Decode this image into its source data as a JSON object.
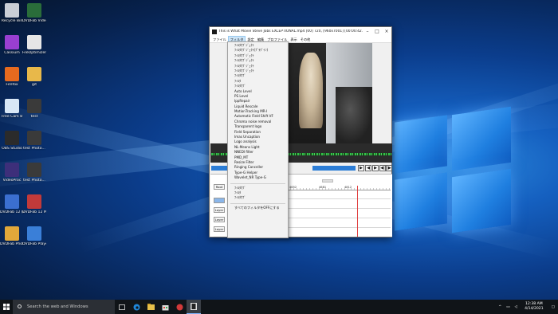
{
  "desktop": {
    "icons": [
      {
        "label": "Recycle Bin",
        "color": "#c9ced6"
      },
      {
        "label": "DVDFab Video Enh...",
        "color": "#2a6d3a"
      },
      {
        "label": "Cassium",
        "color": "#9a3fd0"
      },
      {
        "label": "FileOptimizer",
        "color": "#e6e6e6"
      },
      {
        "label": "Firefox",
        "color": "#e66a1f"
      },
      {
        "label": "git",
        "color": "#e8b84a"
      },
      {
        "label": "Free Cam 8",
        "color": "#d9e7f5"
      },
      {
        "label": "test",
        "color": "#3a3a3a"
      },
      {
        "label": "OBS Studio",
        "color": "#2b2b2b"
      },
      {
        "label": "test Photo...",
        "color": "#3a3a3a"
      },
      {
        "label": "VideoProc",
        "color": "#3d2f7a"
      },
      {
        "label": "test Photo...",
        "color": "#3a3a3a"
      },
      {
        "label": "DVDFab 12 (x64)",
        "color": "#3b6fd0"
      },
      {
        "label": "DVDFab 12 Mini (x64)",
        "color": "#c23a3a"
      },
      {
        "label": "DVDFab Photo En...",
        "color": "#e2a83a"
      },
      {
        "label": "DVDFab Player 6",
        "color": "#3a7fd8"
      }
    ]
  },
  "window": {
    "title": "This is What Movie Steve Jobs EXCEPTIONAL.mp4 [00] 720, [960x7001] [00:00:42.22] E...",
    "menu": [
      "ファイル",
      "フィルタ",
      "設定",
      "編集",
      "プロファイル",
      "表示",
      "その他"
    ],
    "active_menu_index": 1,
    "ruler_ticks": [
      "4652",
      "4681",
      "4812"
    ],
    "layers": [
      "Root",
      "Layer",
      "Layer",
      "Layer",
      "Layer"
    ],
    "controls": [
      "▶",
      "◀",
      "▶",
      "◀|",
      "|▶"
    ]
  },
  "dropdown": {
    "items": [
      "ﾌｨﾙﾀｵﾌﾞｼﾞｪｸﾄ",
      "ﾌｨﾙﾀｵﾌﾞｼﾞｪｸﾄ(ﾌﾟﾗｸﾞｲﾝ)",
      "ﾌｨﾙﾀｵﾌﾞｼﾞｪｸﾄ",
      "ﾌｨﾙﾀｵﾌﾞｼﾞｪｸﾄ",
      "ﾌｨﾙﾀｵﾌﾞｼﾞｪｸﾄ",
      "ﾌｨﾙﾀｵﾌﾞｼﾞｪｸﾄ",
      "ﾌｨﾙﾀｵﾌﾞ",
      "ﾌｨﾙﾀ",
      "ﾌｨﾙﾀｵﾌﾞ",
      "Auto Level",
      "PS Level",
      "IppRepair",
      "Liquid Rescale",
      "MotionTracking MR-I",
      "Automatic Field Shift VF",
      "Chroma noise removal",
      "Transparent logo",
      "Field Separation",
      "Imas Uncaption",
      "Logo analysis",
      "NL-Means Light",
      "NNEDI filter",
      "PMD_MT",
      "Resize Filter",
      "Ringing Canceller",
      "Type-G Helper",
      "Wavelet_NR Type-G"
    ],
    "footer_items": [
      "ﾌｨﾙﾀｵﾌﾞ",
      "ﾌｨﾙﾀ",
      "ﾌｨﾙﾀｵﾌﾞ"
    ],
    "last_item": "すべてのフィルタをOFFにする"
  },
  "taskbar": {
    "search_placeholder": "Search the web and Windows",
    "time": "12:38 AM",
    "date": "4/14/2021",
    "colors": {
      "accent": "#7fb4ff"
    }
  }
}
